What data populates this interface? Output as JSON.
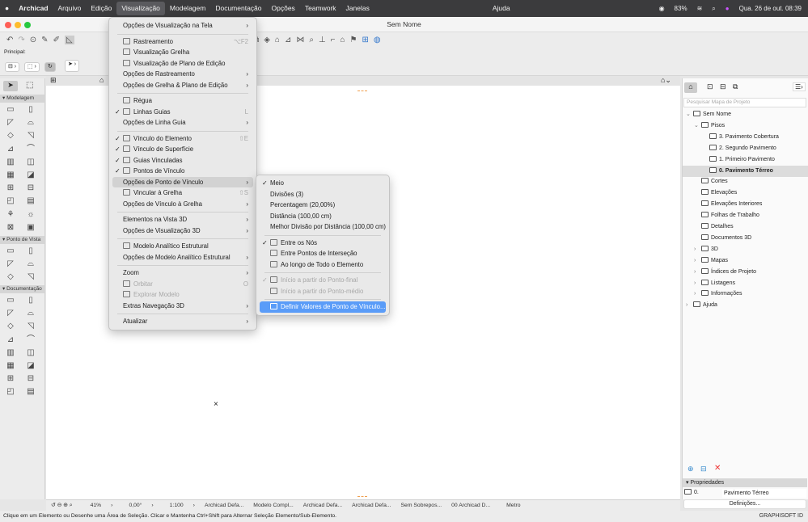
{
  "menubar": {
    "app": "Archicad",
    "items": [
      "Arquivo",
      "Edição",
      "Visualização",
      "Modelagem",
      "Documentação",
      "Opções",
      "Teamwork",
      "Janelas"
    ],
    "help": "Ajuda",
    "active": "Visualização",
    "battery": "83%",
    "clock": "Qua. 26 de out.  08:39"
  },
  "window": {
    "title": "Sem Nome"
  },
  "infobox": {
    "label": "Principal:"
  },
  "toolbox": {
    "sections": [
      "Modelagem",
      "Ponto de Vista",
      "Documentação"
    ]
  },
  "view_menu": [
    {
      "label": "Opções de Visualização na Tela",
      "sub": true
    },
    {
      "sep": true
    },
    {
      "label": "Rastreamento",
      "icon": "trace-icon",
      "shortcut": "⌥F2"
    },
    {
      "label": "Visualização Grelha",
      "icon": "grid-icon"
    },
    {
      "label": "Visualização de Plano de Edição",
      "icon": "editing-plane-icon"
    },
    {
      "label": "Opções de Rastreamento",
      "sub": true
    },
    {
      "label": "Opções de Grelha & Plano de Edição",
      "sub": true
    },
    {
      "sep": true
    },
    {
      "label": "Régua",
      "icon": "ruler-icon"
    },
    {
      "label": "Linhas Guias",
      "icon": "guide-lines-icon",
      "checked": true,
      "shortcut": "L"
    },
    {
      "label": "Opções de Linha Guia",
      "sub": true
    },
    {
      "sep": true
    },
    {
      "label": "Vínculo do Elemento",
      "icon": "element-snap-icon",
      "checked": true,
      "shortcut": "⇧E"
    },
    {
      "label": "Vínculo de Superfície",
      "icon": "surface-snap-icon",
      "checked": true
    },
    {
      "label": "Guias Vinculadas",
      "icon": "snap-guides-icon",
      "checked": true
    },
    {
      "label": "Pontos de Vínculo",
      "icon": "snap-points-icon",
      "checked": true
    },
    {
      "label": "Opções de Ponto de Vínculo",
      "sub": true,
      "highlighted": true
    },
    {
      "label": "Vincular à Grelha",
      "icon": "grid-snap-icon",
      "shortcut": "⇧S"
    },
    {
      "label": "Opções de Vínculo à Grelha",
      "sub": true
    },
    {
      "sep": true
    },
    {
      "label": "Elementos na Vista 3D",
      "sub": true
    },
    {
      "label": "Opções de Visualização 3D",
      "sub": true
    },
    {
      "sep": true
    },
    {
      "label": "Modelo Analítico Estrutural",
      "icon": "structural-model-icon"
    },
    {
      "label": "Opções de Modelo Analítico Estrutural",
      "sub": true
    },
    {
      "sep": true
    },
    {
      "label": "Zoom",
      "sub": true
    },
    {
      "label": "Orbitar",
      "icon": "orbit-icon",
      "disabled": true,
      "shortcut": "O"
    },
    {
      "label": "Explorar Modelo",
      "icon": "explore-icon",
      "disabled": true
    },
    {
      "label": "Extras Navegação 3D",
      "sub": true
    },
    {
      "sep": true
    },
    {
      "label": "Atualizar",
      "sub": true
    }
  ],
  "snap_submenu": [
    {
      "label": "Meio",
      "checked": true
    },
    {
      "label": "Divisões (3)"
    },
    {
      "label": "Percentagem (20,00%)"
    },
    {
      "label": "Distância (100,00 cm)"
    },
    {
      "label": "Melhor Divisão por Distância (100,00 cm)"
    },
    {
      "sep": true
    },
    {
      "label": "Entre os Nós",
      "icon": "between-nodes-icon",
      "checked": true
    },
    {
      "label": "Entre Pontos de Interseção",
      "icon": "between-intersections-icon"
    },
    {
      "label": "Ao longo de Todo o Elemento",
      "icon": "along-element-icon"
    },
    {
      "sep": true
    },
    {
      "label": "Início a partir do Ponto-final",
      "icon": "from-endpoint-icon",
      "checked": true,
      "disabled": true
    },
    {
      "label": "Início a partir do Ponto-médio",
      "icon": "from-midpoint-icon",
      "disabled": true
    },
    {
      "sep": true
    },
    {
      "label": "Definir Valores de Ponto de Vínculo...",
      "icon": "set-snap-values-icon",
      "selected": true
    }
  ],
  "navigator": {
    "search_placeholder": "Pesquisar Mapa de Projeto",
    "tree": [
      {
        "label": "Sem Nome",
        "level": 0,
        "exp": "open"
      },
      {
        "label": "Pisos",
        "level": 1,
        "exp": "open"
      },
      {
        "label": "3. Pavimento Cobertura",
        "level": 2
      },
      {
        "label": "2. Segundo Pavimento",
        "level": 2
      },
      {
        "label": "1. Primeiro Pavimento",
        "level": 2
      },
      {
        "label": "0. Pavimento Térreo",
        "level": 2,
        "selected": true
      },
      {
        "label": "Cortes",
        "level": 1
      },
      {
        "label": "Elevações",
        "level": 1
      },
      {
        "label": "Elevações Interiores",
        "level": 1
      },
      {
        "label": "Folhas de Trabalho",
        "level": 1
      },
      {
        "label": "Detalhes",
        "level": 1
      },
      {
        "label": "Documentos 3D",
        "level": 1
      },
      {
        "label": "3D",
        "level": 1,
        "exp": "closed"
      },
      {
        "label": "Mapas",
        "level": 1,
        "exp": "closed"
      },
      {
        "label": "Índices de Projeto",
        "level": 1,
        "exp": "closed"
      },
      {
        "label": "Listagens",
        "level": 1,
        "exp": "closed"
      },
      {
        "label": "Informações",
        "level": 1,
        "exp": "closed"
      },
      {
        "label": "Ajuda",
        "level": 0,
        "exp": "closed"
      }
    ]
  },
  "properties": {
    "title": "Propriedades",
    "id": "0.",
    "name": "Pavimento Térreo",
    "button": "Definições..."
  },
  "statusbar": {
    "zoom": "41%",
    "angle": "0,00°",
    "scale": "1:100",
    "layers": "Archicad Defa...",
    "model": "Modelo Compl...",
    "pen": "Archicad Defa...",
    "display": "Archicad Defa...",
    "overrides": "Sem Sobrepos...",
    "renovation": "00 Archicad D...",
    "unit": "Metro"
  },
  "message": "Clique em um Elemento ou Desenhe uma Área de Seleção. Clicar e Mantenha Ctrl+Shift para Alternar Seleção Elemento/Sub-Elemento.",
  "brand": "GRAPHISOFT ID",
  "colors": {
    "accent": "#5a9cf8",
    "menubar": "#3b3b3d"
  }
}
